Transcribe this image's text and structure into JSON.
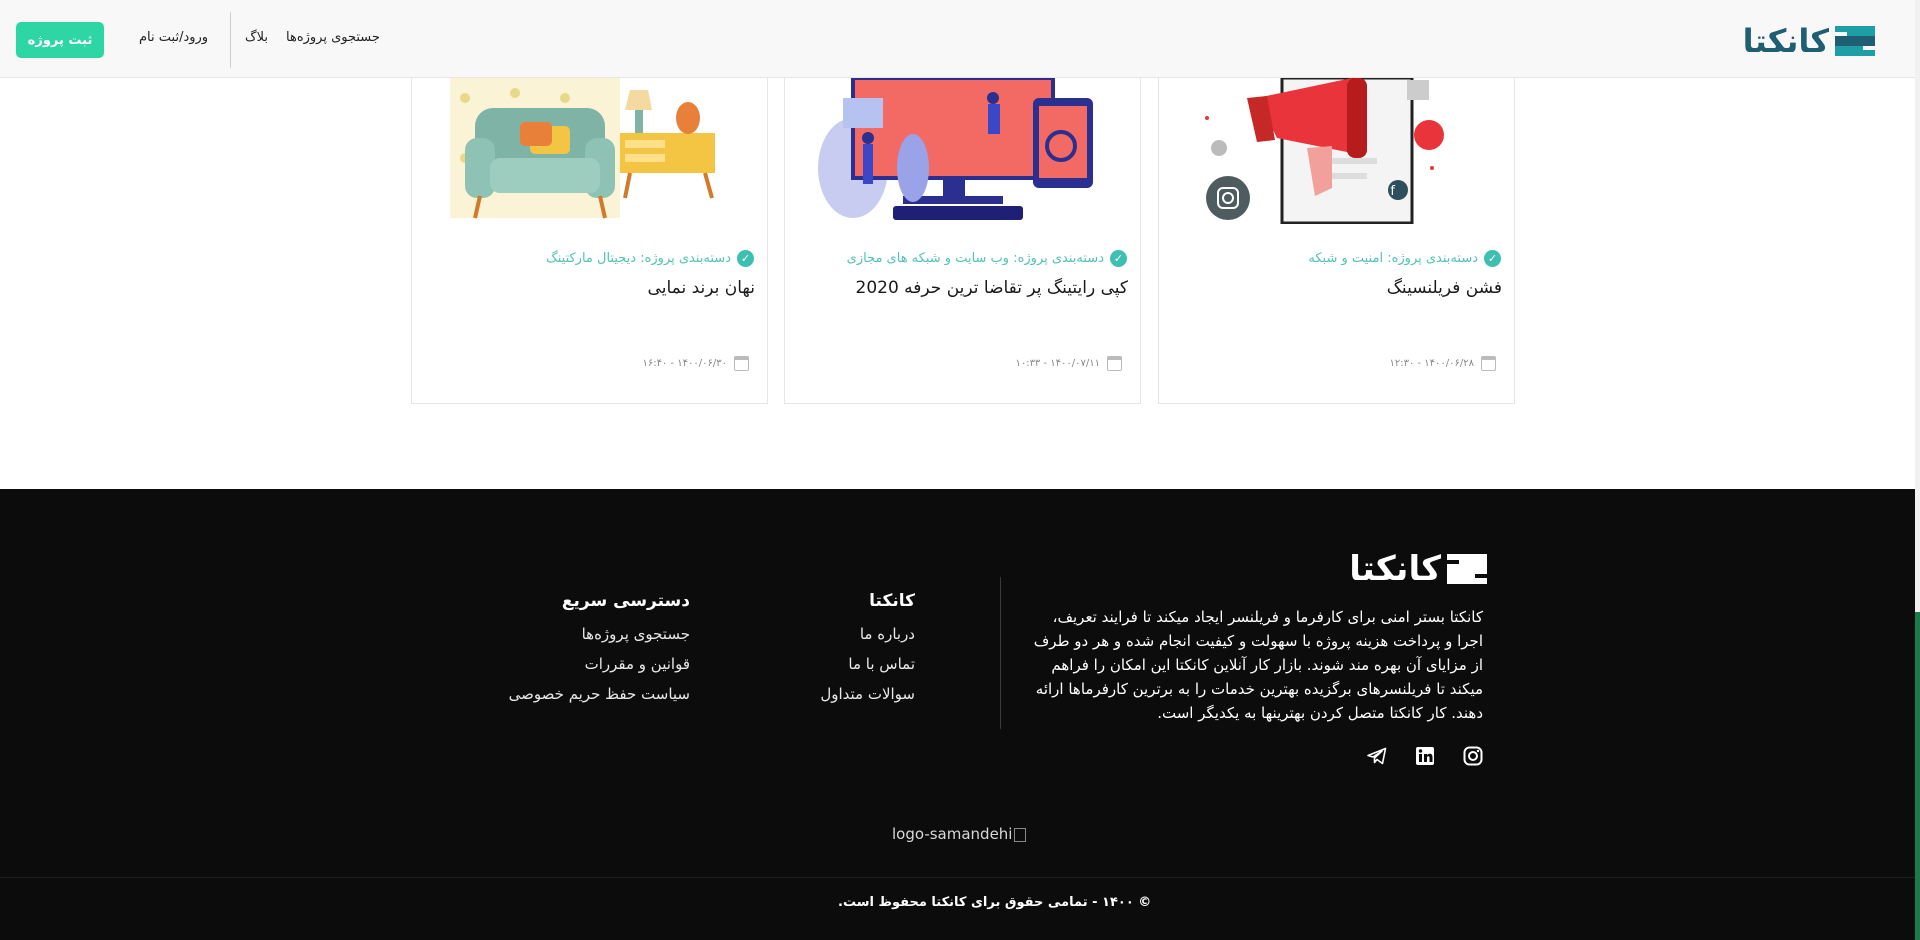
{
  "header": {
    "logo_text": "کانکتا",
    "register_project": "ثبت پروژه",
    "login": "ورود/ثبت نام",
    "blog": "بلاگ",
    "search_projects": "جستجوی پروژه‌ها"
  },
  "cards": [
    {
      "category": "دسته‌بندی پروژه: امنیت و شبکه",
      "title": "فشن فریلنسینگ",
      "date": "۱۴۰۰/۰۶/۲۸ - ۱۲:۳۰"
    },
    {
      "category": "دسته‌بندی پروژه: وب سایت و شبکه های مجازی",
      "title": "کپی رایتینگ پر تقاضا ترین حرفه 2020",
      "date": "۱۴۰۰/۰۷/۱۱ - ۱۰:۳۳"
    },
    {
      "category": "دسته‌بندی پروژه: دیجیتال مارکتینگ",
      "title": "نهان برند نمایی",
      "date": "۱۴۰۰/۰۶/۳۰ - ۱۶:۴۰"
    }
  ],
  "footer": {
    "logo_text": "کانکتا",
    "about": "کانکتا بستر امنی برای کارفرما و فریلنسر ایجاد میکند تا فرایند تعریف، اجرا و پرداخت هزینه پروژه با سهولت و کیفیت انجام شده و هر دو طرف از مزایای آن بهره مند شوند. بازار کار آنلاین کانکتا این امکان را فراهم میکند تا فریلنسرهای برگزیده بهترین خدمات را به برترین کارفرماها ارائه دهند. کار کانکتا متصل کردن بهترینها به یکدیگر است.",
    "col_kanekta": {
      "title": "کانکتا",
      "links": [
        "درباره ما",
        "تماس با ما",
        "سوالات متداول"
      ]
    },
    "col_quick": {
      "title": "دسترسی سریع",
      "links": [
        "جستجوی پروژه‌ها",
        "قوانین و مقررات",
        "سیاست حفظ حریم خصوصی"
      ]
    },
    "samandehi_alt": "logo-samandehi",
    "copyright": "© ۱۴۰۰ - تمامی حقوق برای کانکتا محفوظ است."
  },
  "icons": {
    "instagram": "instagram-icon",
    "linkedin": "linkedin-icon",
    "telegram": "telegram-icon",
    "verified": "check-circle-icon",
    "calendar": "calendar-icon"
  },
  "colors": {
    "accent": "#2fd6a5",
    "brand_dark": "#1e5f74",
    "brand_light": "#1e9fa5",
    "category_text": "#52c2b5",
    "footer_bg": "#0c0c0c"
  }
}
